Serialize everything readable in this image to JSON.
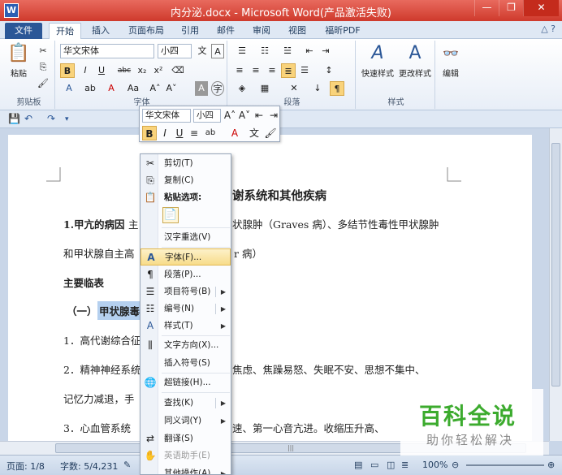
{
  "window": {
    "title": "内分泌.docx - Microsoft Word(产品激活失败)",
    "app_icon": "W",
    "minimize": "—",
    "restore": "❐",
    "close": "✕"
  },
  "tabs": [
    "文件",
    "开始",
    "插入",
    "页面布局",
    "引用",
    "邮件",
    "审阅",
    "视图",
    "福昕PDF"
  ],
  "ribbon": {
    "clipboard": {
      "label": "剪贴板",
      "paste": "粘贴"
    },
    "font": {
      "label": "字体",
      "font_name": "华文宋体",
      "font_size": "小四",
      "bold": "B",
      "italic": "I",
      "underline": "U",
      "strike": "abc",
      "sub": "x₂",
      "sup": "x²"
    },
    "paragraph": {
      "label": "段落"
    },
    "styles": {
      "label": "样式",
      "quick_styles": "快速样式",
      "change_styles": "更改样式"
    },
    "editing": {
      "label": "编辑"
    }
  },
  "mini_toolbar": {
    "font_name": "华文宋体",
    "font_size": "小四"
  },
  "document": {
    "heading": "谢系统和其他疾病",
    "line1_a": "1.甲亢的病因",
    "line1_b": "主",
    "line1_c": "状腺肿（Graves 病）、多结节性毒性甲状腺肿",
    "line2_a": "和甲状腺自主高",
    "line2_b": "r 病）",
    "section": "主要临表",
    "sub1_a": "（一）",
    "sub1_b": "甲状腺毒",
    "item1": "1．高代谢综合征",
    "item2_a": "2．精神神经系统",
    "item2_b": "焦虑、焦躁易怒、失眠不安、思想不集中、",
    "item3": "记忆力减退，手",
    "item4_a": "3．心血管系统",
    "item4_b": "速、第一心音亢进。收缩压升高、"
  },
  "context_menu": {
    "cut": "剪切(T)",
    "copy": "复制(C)",
    "paste_options": "粘贴选项:",
    "hanzi": "汉字重选(V)",
    "font": "字体(F)...",
    "paragraph": "段落(P)...",
    "bullets": "项目符号(B)",
    "numbering": "编号(N)",
    "styles": "样式(T)",
    "text_direction": "文字方向(X)...",
    "insert_symbol": "插入符号(S)",
    "hyperlink": "超链接(H)...",
    "lookup": "查找(K)",
    "synonyms": "同义词(Y)",
    "translate": "翻译(S)",
    "english_assistant": "英语助手(E)",
    "other": "其他操作(A)"
  },
  "statusbar": {
    "page": "页面: 1/8",
    "words": "字数: 5/4,231",
    "zoom": "100%"
  },
  "watermark": {
    "title": "百科全说",
    "subtitle": "助你轻松解决"
  },
  "colors": {
    "titlebar": "#cf3a2c",
    "file_tab": "#2b5797",
    "highlight": "#b5d0ef",
    "watermark_green": "#3cab2e"
  }
}
